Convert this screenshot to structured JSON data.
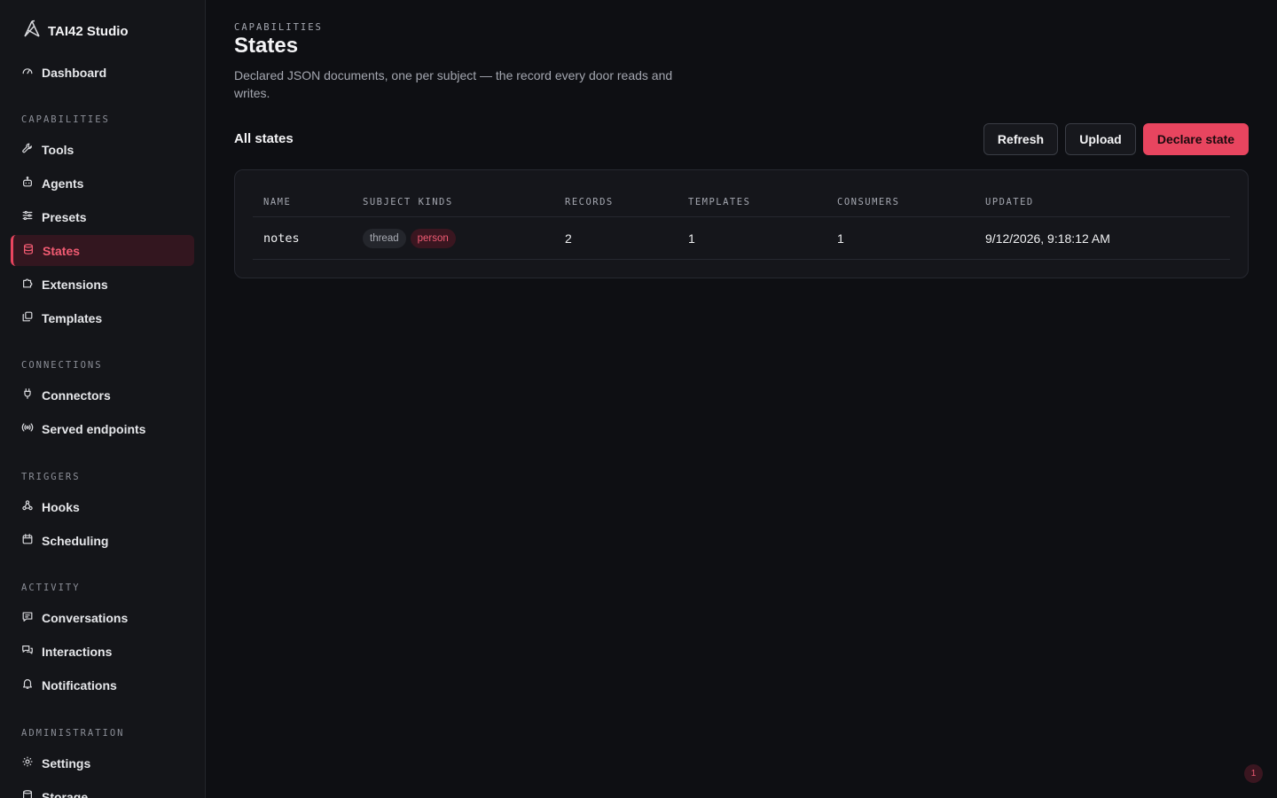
{
  "brand": {
    "name": "TAI42 Studio",
    "icon": "logo-icon"
  },
  "sidebar": {
    "dashboard": {
      "label": "Dashboard",
      "icon": "gauge-icon"
    },
    "sections": [
      {
        "label": "CAPABILITIES"
      },
      {
        "label": "CONNECTIONS"
      },
      {
        "label": "TRIGGERS"
      },
      {
        "label": "ACTIVITY"
      },
      {
        "label": "ADMINISTRATION"
      }
    ],
    "items": [
      {
        "label": "Tools",
        "icon": "wrench-icon"
      },
      {
        "label": "Agents",
        "icon": "bot-icon"
      },
      {
        "label": "Presets",
        "icon": "sliders-icon"
      },
      {
        "label": "States",
        "icon": "database-icon",
        "active": true
      },
      {
        "label": "Extensions",
        "icon": "puzzle-icon"
      },
      {
        "label": "Templates",
        "icon": "copy-icon"
      },
      {
        "label": "Connectors",
        "icon": "plug-icon"
      },
      {
        "label": "Served endpoints",
        "icon": "broadcast-icon"
      },
      {
        "label": "Hooks",
        "icon": "webhook-icon"
      },
      {
        "label": "Scheduling",
        "icon": "calendar-icon"
      },
      {
        "label": "Conversations",
        "icon": "message-icon"
      },
      {
        "label": "Interactions",
        "icon": "chats-icon"
      },
      {
        "label": "Notifications",
        "icon": "bell-icon"
      },
      {
        "label": "Settings",
        "icon": "gear-icon"
      },
      {
        "label": "Storage",
        "icon": "storage-icon"
      }
    ]
  },
  "header": {
    "eyebrow": "CAPABILITIES",
    "title": "States",
    "description": "Declared JSON documents, one per subject — the record every door reads and writes."
  },
  "toolbar": {
    "section_title": "All states",
    "refresh_label": "Refresh",
    "upload_label": "Upload",
    "declare_label": "Declare state"
  },
  "table": {
    "columns": [
      "NAME",
      "SUBJECT KINDS",
      "RECORDS",
      "TEMPLATES",
      "CONSUMERS",
      "UPDATED"
    ],
    "rows": [
      {
        "name": "notes",
        "subject_kinds": [
          "thread",
          "person"
        ],
        "records": "2",
        "templates": "1",
        "consumers": "1",
        "updated": "9/12/2026, 9:18:12 AM"
      }
    ]
  },
  "notification_badge": {
    "count": "1"
  },
  "colors": {
    "accent": "#e8455f",
    "background": "#0e0f13",
    "sidebar": "#141519",
    "active_bg": "#33161f"
  }
}
